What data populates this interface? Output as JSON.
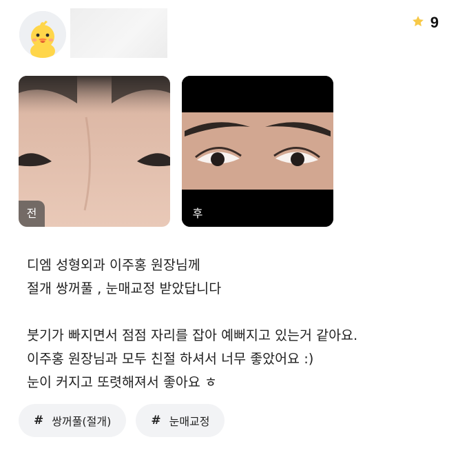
{
  "header": {
    "avatar": "duck-avatar-icon",
    "rating": {
      "icon": "star-icon",
      "value": "9",
      "star_color": "#F7C948"
    }
  },
  "photos": [
    {
      "label": "전"
    },
    {
      "label": "후"
    }
  ],
  "review": {
    "lines": [
      "디엠 성형외과 이주홍 원장님께",
      "절개 쌍꺼풀 , 눈매교정 받았답니다",
      "",
      "붓기가 빠지면서 점점 자리를 잡아 예뻐지고 있는거 같아요.",
      "이주홍 원장님과 모두 친절 하셔서 너무 좋았어요 :)",
      "눈이 커지고 또렷해져서 좋아요 ㅎ"
    ]
  },
  "hashtags": [
    {
      "symbol": "#",
      "text": "쌍꺼풀(절개)"
    },
    {
      "symbol": "#",
      "text": "눈매교정"
    }
  ]
}
